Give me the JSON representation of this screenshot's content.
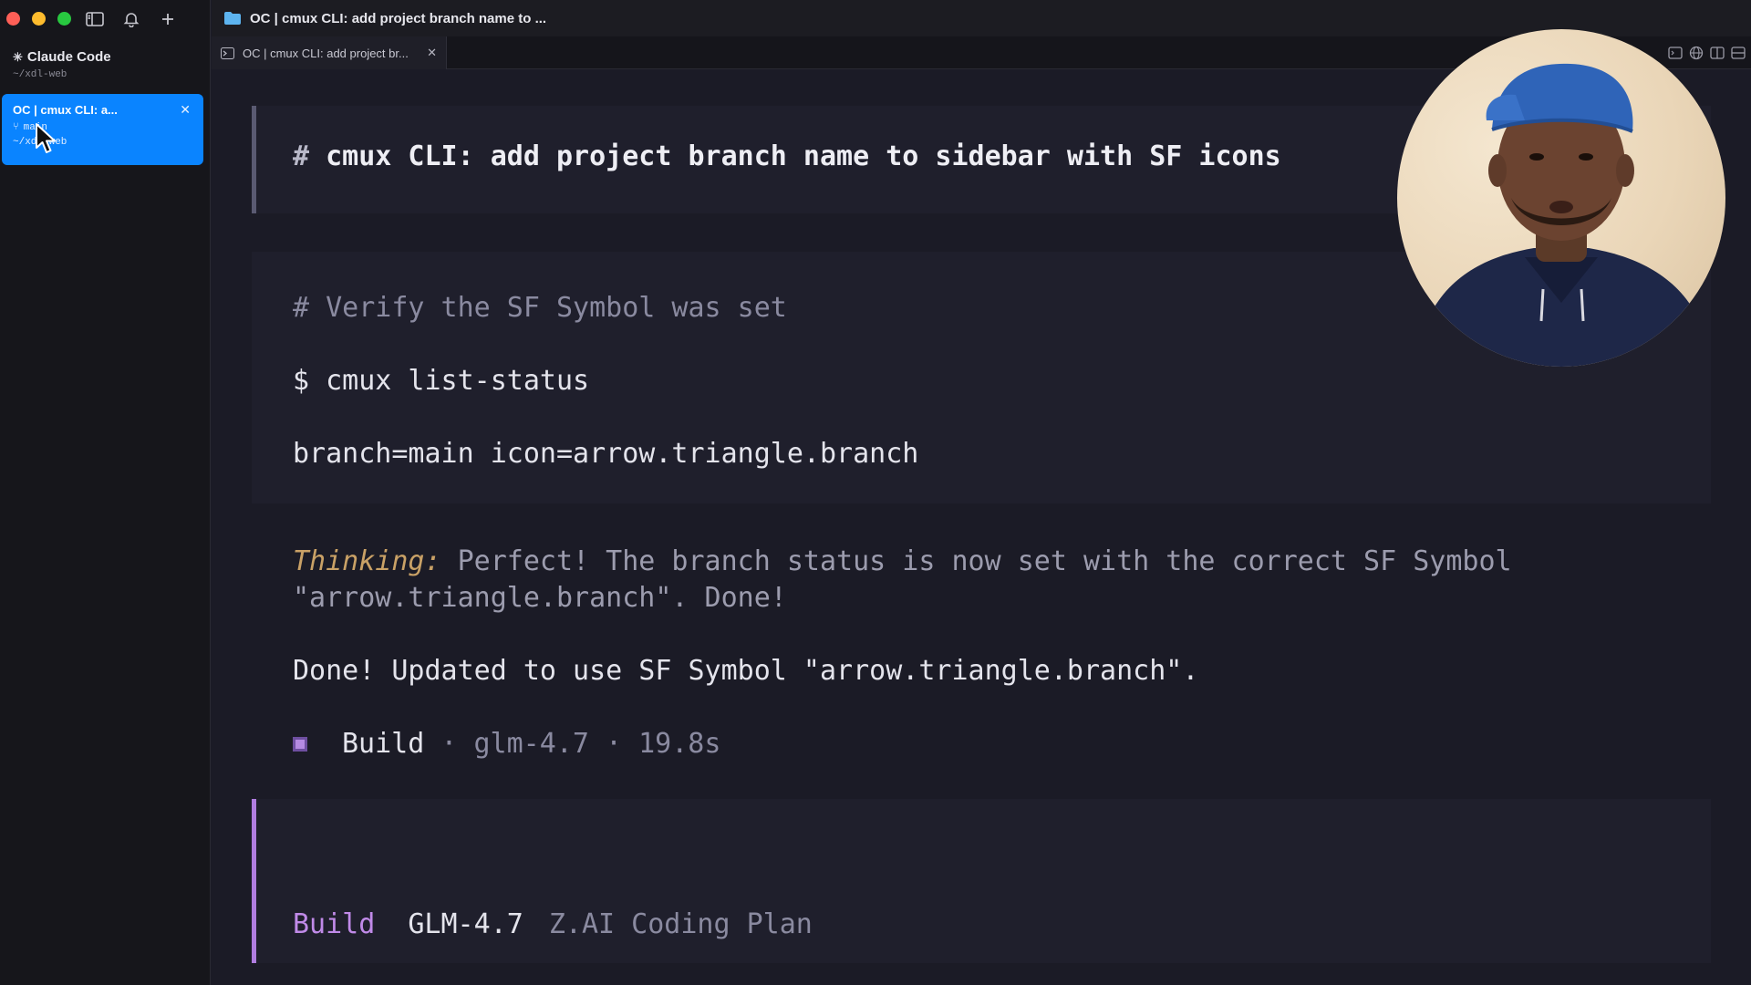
{
  "sidebar": {
    "workspace_title": "Claude Code",
    "workspace_path": "~/xdl-web",
    "active_item": {
      "title": "OC | cmux CLI: a...",
      "branch": "main",
      "path": "~/xdl-web"
    }
  },
  "window": {
    "title": "OC | cmux CLI: add project branch name to ..."
  },
  "tabs": [
    {
      "label": "OC | cmux CLI: add project br..."
    }
  ],
  "content": {
    "heading_hash": "#",
    "heading_text": "cmux CLI: add project branch name to sidebar with SF icons",
    "code": {
      "comment": "# Verify the SF Symbol was set",
      "command": "$ cmux list-status",
      "output": "branch=main icon=arrow.triangle.branch"
    },
    "thinking_label": "Thinking:",
    "thinking_text": "Perfect! The branch status is now set with the correct SF Symbol \"arrow.triangle.branch\". Done!",
    "done_text": "Done! Updated to use SF Symbol \"arrow.triangle.branch\".",
    "build": {
      "name": "Build",
      "meta": "· glm-4.7 · 19.8s"
    },
    "input": {
      "mode": "Build",
      "model": "GLM-4.7",
      "plan": "Z.AI Coding Plan"
    }
  },
  "colors": {
    "accent_blue": "#0a84ff",
    "thinking_label": "#c9a166",
    "build_purple": "#c08ae8"
  }
}
